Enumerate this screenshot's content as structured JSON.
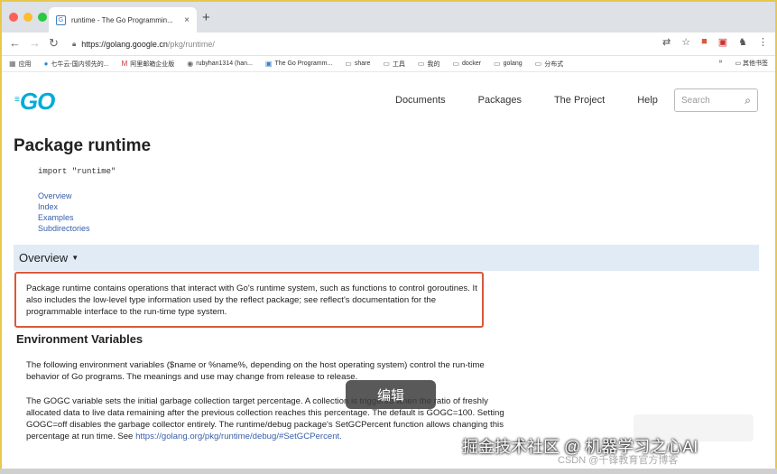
{
  "browser": {
    "tab_title": "runtime - The Go Programmin...",
    "tab_favicon": "go-gopher-icon",
    "new_tab": "+",
    "close_tab": "×",
    "url_host": "https://golang.google.cn",
    "url_path": "/pkg/runtime/"
  },
  "bookmarks": {
    "items": [
      {
        "icon": "apps-icon",
        "label": "应用"
      },
      {
        "icon": "qiniu-icon",
        "label": "七牛云-国内领先的..."
      },
      {
        "icon": "gmail-icon",
        "label": "阿里邮箱企业版"
      },
      {
        "icon": "github-icon",
        "label": "rubyhan1314 (han..."
      },
      {
        "icon": "go-icon",
        "label": "The Go Programm..."
      },
      {
        "icon": "folder-icon",
        "label": "share"
      },
      {
        "icon": "folder-icon",
        "label": "工具"
      },
      {
        "icon": "folder-icon",
        "label": "我的"
      },
      {
        "icon": "folder-icon",
        "label": "docker"
      },
      {
        "icon": "folder-icon",
        "label": "golang"
      },
      {
        "icon": "folder-icon",
        "label": "分布式"
      }
    ],
    "more": "»",
    "other": "其他书签"
  },
  "site": {
    "logo": "GO",
    "nav": [
      "Documents",
      "Packages",
      "The Project",
      "Help"
    ],
    "search_placeholder": "Search"
  },
  "content": {
    "title": "Package runtime",
    "import_line": "import \"runtime\"",
    "toc": [
      "Overview",
      "Index",
      "Examples",
      "Subdirectories"
    ],
    "overview_heading": "Overview",
    "overview_text": "Package runtime contains operations that interact with Go's runtime system, such as functions to control goroutines. It also includes the low-level type information used by the reflect package; see reflect's documentation for the programmable interface to the run-time type system.",
    "env_heading": "Environment Variables",
    "env_para1": "The following environment variables ($name or %name%, depending on the host operating system) control the run-time behavior of Go programs. The meanings and use may change from release to release.",
    "env_para2": "The GOGC variable sets the initial garbage collection target percentage. A collection is triggered when the ratio of freshly allocated data to live data remaining after the previous collection reaches this percentage. The default is GOGC=100. Setting GOGC=off disables the garbage collector entirely. The runtime/debug package's SetGCPercent function allows changing this percentage at run time. See",
    "env_link": "https://golang.org/pkg/runtime/debug/#SetGCPercent."
  },
  "overlay": {
    "edit_button": "编辑",
    "watermark_large": "掘金技术社区 @ 机器学习之心AI",
    "watermark_small": "CSDN @千锋教育官方博客"
  }
}
